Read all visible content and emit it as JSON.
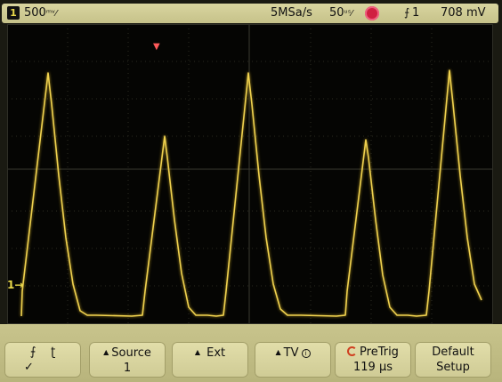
{
  "status": {
    "channel": "1",
    "volts_per_div": "500",
    "volts_unit": "ᵐᵛ⁄",
    "sample_rate": "5MSa/s",
    "time_per_div": "50",
    "time_unit": "ᵘˢ⁄",
    "trigger_channel": "1",
    "trigger_level": "708 mV",
    "trigger_slope_icon": "rising-edge-icon",
    "run_state_icon": "stop-indicator-icon",
    "trace_color": "#f0d250",
    "stop_color": "#d02040"
  },
  "markers": {
    "left_channel": "1→",
    "ground": "1↓",
    "right_level": "←",
    "trigger_position": "▼"
  },
  "softkeys": {
    "slope": {
      "rising": "⨍",
      "falling": "ʈ",
      "check": "✓"
    },
    "source": {
      "label": "Source",
      "value": "1"
    },
    "ext": {
      "label": "Ext"
    },
    "tv": {
      "label": "TV",
      "info": "i"
    },
    "pretrig": {
      "label": "PreTrig",
      "value": "119 µs"
    },
    "default_setup": {
      "line1": "Default",
      "line2": "Setup"
    }
  }
}
